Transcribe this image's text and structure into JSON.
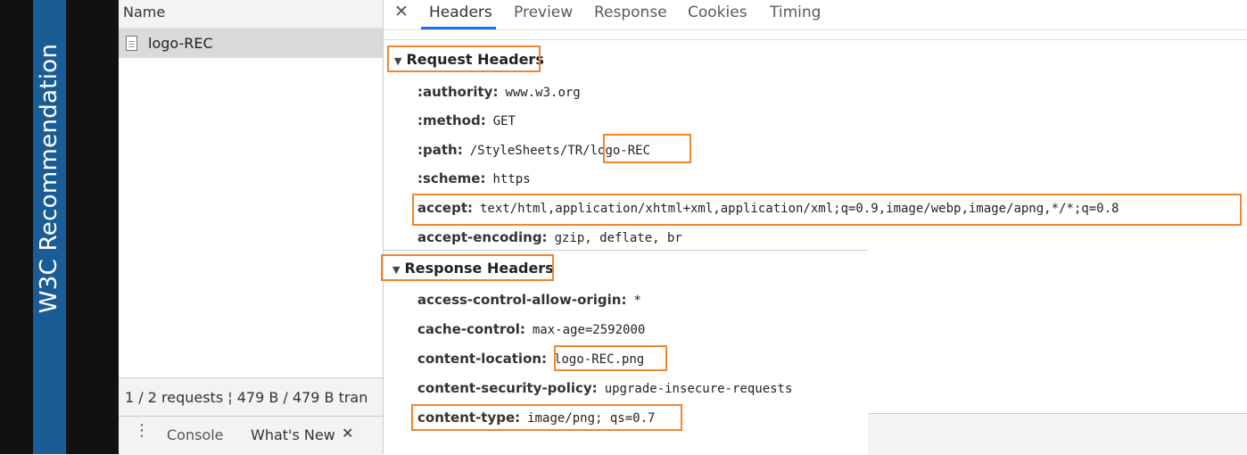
{
  "banner": {
    "text": "W3C Recommendation"
  },
  "list": {
    "header": "Name",
    "requests": [
      {
        "name": "logo-REC"
      }
    ],
    "status": "1 / 2 requests ¦ 479 B / 479 B tran"
  },
  "drawer": {
    "menu_icon": "kebab-icon",
    "tabs": [
      "Console",
      "What's New"
    ],
    "close": "✕"
  },
  "details": {
    "close": "✕",
    "tabs": [
      "Headers",
      "Preview",
      "Response",
      "Cookies",
      "Timing"
    ],
    "active_tab": "Headers",
    "request_section": "Request Headers",
    "response_section": "Response Headers",
    "request_headers": [
      {
        "key": ":authority:",
        "value": "www.w3.org"
      },
      {
        "key": ":method:",
        "value": "GET"
      },
      {
        "key": ":path:",
        "value_prefix": "/StyleSheets/TR",
        "value": "/logo-REC"
      },
      {
        "key": ":scheme:",
        "value": "https"
      },
      {
        "key": "accept:",
        "value": "text/html,application/xhtml+xml,application/xml;q=0.9,image/webp,image/apng,*/*;q=0.8"
      },
      {
        "key": "accept-encoding:",
        "value": "gzip, deflate, br"
      }
    ],
    "response_headers": [
      {
        "key": "access-control-allow-origin:",
        "value": "*"
      },
      {
        "key": "cache-control:",
        "value": "max-age=2592000"
      },
      {
        "key": "content-location:",
        "value": "logo-REC.png"
      },
      {
        "key": "content-security-policy:",
        "value": "upgrade-insecure-requests"
      },
      {
        "key": "content-type:",
        "value": "image/png; qs=0.7"
      }
    ]
  },
  "colors": {
    "highlight": "#f0852f",
    "banner": "#1a5d96",
    "accent": "#1a73e8"
  }
}
